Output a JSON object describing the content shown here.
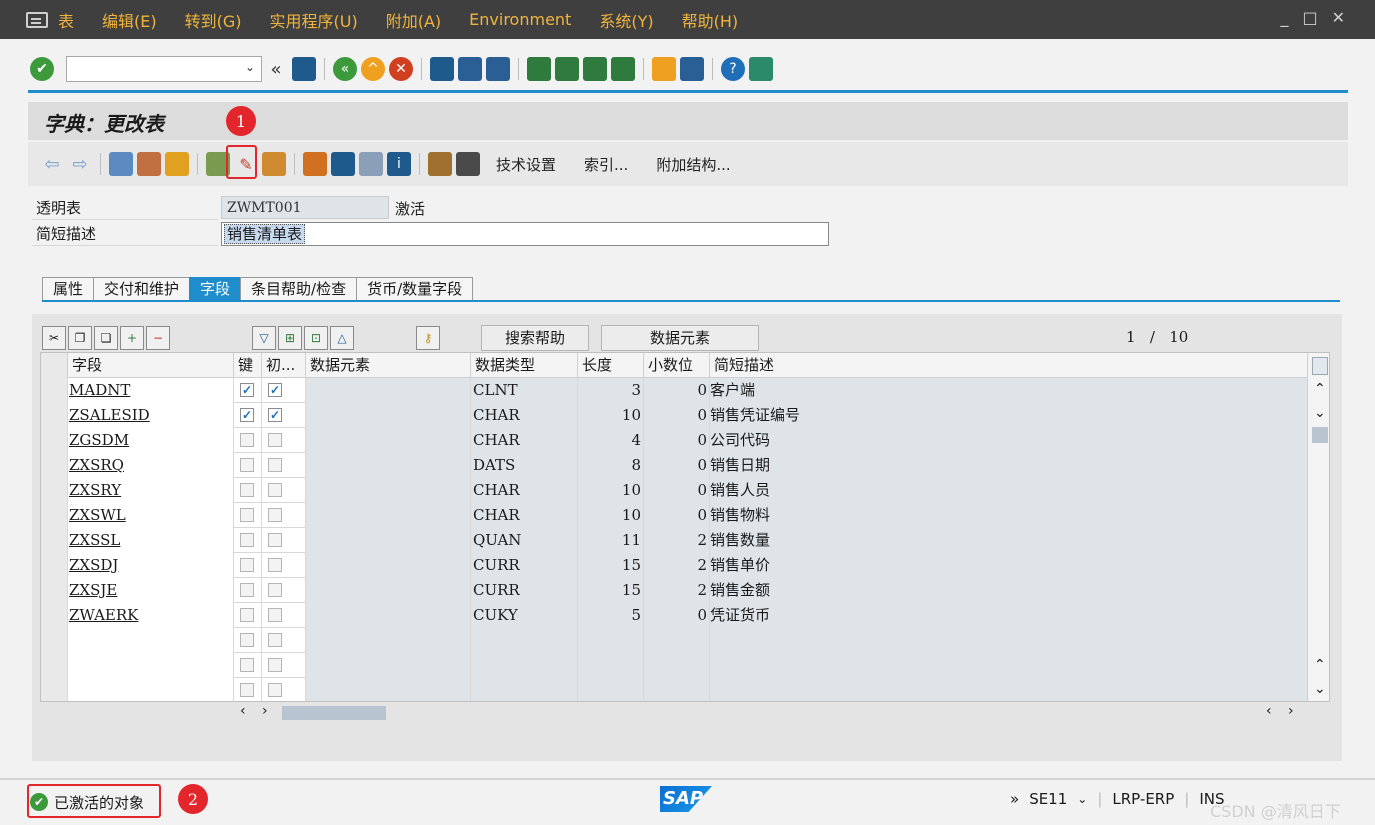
{
  "menubar": {
    "items": [
      "表",
      "编辑(E)",
      "转到(G)",
      "实用程序(U)",
      "附加(A)",
      "Environment",
      "系统(Y)",
      "帮助(H)"
    ],
    "window_controls": [
      "_",
      "□",
      "✕"
    ]
  },
  "toolbar1": {
    "command_value": "",
    "icons": [
      "enter-icon",
      "back-icon",
      "save-icon",
      "back-green-icon",
      "exit-icon",
      "cancel-icon",
      "print-icon",
      "find-icon",
      "find-next-icon",
      "first-page-icon",
      "prev-page-icon",
      "next-page-icon",
      "last-page-icon",
      "new-session-icon",
      "shortcut-icon",
      "help-icon",
      "customize-icon"
    ]
  },
  "title": "字典：更改表",
  "annotations": {
    "badge1": "1",
    "badge2": "2"
  },
  "toolbar2": {
    "btn_tech_settings": "技术设置",
    "btn_index": "索引...",
    "btn_append_struct": "附加结构..."
  },
  "form": {
    "table_label": "透明表",
    "table_name": "ZWMT001",
    "table_status": "激活",
    "short_desc_label": "简短描述",
    "short_desc_value": "销售清单表"
  },
  "tabs": [
    "属性",
    "交付和维护",
    "字段",
    "条目帮助/检查",
    "货币/数量字段"
  ],
  "active_tab": 2,
  "table_toolbar": {
    "search_help": "搜索帮助",
    "data_element": "数据元素",
    "pager_current": "1",
    "pager_sep": "/",
    "pager_total": "10"
  },
  "columns": [
    "字段",
    "键",
    "初...",
    "数据元素",
    "数据类型",
    "长度",
    "小数位",
    "简短描述"
  ],
  "rows": [
    {
      "field": "MADNT",
      "key": true,
      "init": true,
      "de": "",
      "type": "CLNT",
      "len": "3",
      "dec": "0",
      "desc": "客户端"
    },
    {
      "field": "ZSALESID",
      "key": true,
      "init": true,
      "de": "",
      "type": "CHAR",
      "len": "10",
      "dec": "0",
      "desc": "销售凭证编号"
    },
    {
      "field": "ZGSDM",
      "key": false,
      "init": false,
      "de": "",
      "type": "CHAR",
      "len": "4",
      "dec": "0",
      "desc": "公司代码"
    },
    {
      "field": "ZXSRQ",
      "key": false,
      "init": false,
      "de": "",
      "type": "DATS",
      "len": "8",
      "dec": "0",
      "desc": "销售日期"
    },
    {
      "field": "ZXSRY",
      "key": false,
      "init": false,
      "de": "",
      "type": "CHAR",
      "len": "10",
      "dec": "0",
      "desc": "销售人员"
    },
    {
      "field": "ZXSWL",
      "key": false,
      "init": false,
      "de": "",
      "type": "CHAR",
      "len": "10",
      "dec": "0",
      "desc": "销售物料"
    },
    {
      "field": "ZXSSL",
      "key": false,
      "init": false,
      "de": "",
      "type": "QUAN",
      "len": "11",
      "dec": "2",
      "desc": "销售数量"
    },
    {
      "field": "ZXSDJ",
      "key": false,
      "init": false,
      "de": "",
      "type": "CURR",
      "len": "15",
      "dec": "2",
      "desc": "销售单价"
    },
    {
      "field": "ZXSJE",
      "key": false,
      "init": false,
      "de": "",
      "type": "CURR",
      "len": "15",
      "dec": "2",
      "desc": "销售金额"
    },
    {
      "field": "ZWAERK",
      "key": false,
      "init": false,
      "de": "",
      "type": "CUKY",
      "len": "5",
      "dec": "0",
      "desc": "凭证货币"
    },
    {
      "field": "",
      "key": false,
      "init": false,
      "de": "",
      "type": "",
      "len": "",
      "dec": "",
      "desc": ""
    },
    {
      "field": "",
      "key": false,
      "init": false,
      "de": "",
      "type": "",
      "len": "",
      "dec": "",
      "desc": ""
    },
    {
      "field": "",
      "key": false,
      "init": false,
      "de": "",
      "type": "",
      "len": "",
      "dec": "",
      "desc": ""
    }
  ],
  "status": {
    "message": "已激活的对象",
    "sap": "SAP",
    "more": "»",
    "tcode": "SE11",
    "system": "LRP-ERP",
    "mode": "INS"
  },
  "watermark": "CSDN @清风日下",
  "colors": {
    "accent": "#1f8dcb",
    "menu_text": "#f0b43c",
    "badge": "#e2262c"
  }
}
